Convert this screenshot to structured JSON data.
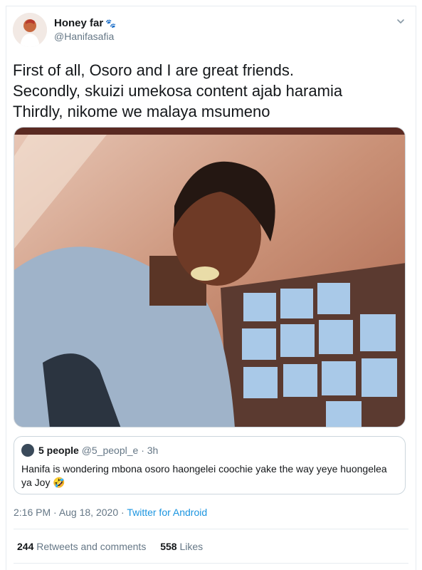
{
  "user": {
    "display_name": "Honey far",
    "name_emoji": "🐾",
    "handle": "@Hanifasafia"
  },
  "tweet": {
    "text": "First of all, Osoro and I are great friends.\nSecondly, skuizi umekosa content ajab haramia\nThirdly,  nikome we malaya msumeno"
  },
  "quote": {
    "name": "5 people",
    "handle": "@5_peopl_e",
    "separator": "·",
    "time": "3h",
    "text": "Hanifa is wondering mbona osoro haongelei coochie yake the way yeye huongelea ya Joy 🤣"
  },
  "meta": {
    "time": "2:16 PM",
    "separator1": " · ",
    "date": "Aug 18, 2020",
    "separator2": " · ",
    "source": "Twitter for Android"
  },
  "stats": {
    "retweets_count": "244",
    "retweets_label": "Retweets and comments",
    "likes_count": "558",
    "likes_label": "Likes"
  },
  "icons": {
    "menu": "chevron-down-icon"
  },
  "colors": {
    "accent": "#1b95e0",
    "secondary_text": "#657786",
    "border": "#e6ecf0"
  }
}
